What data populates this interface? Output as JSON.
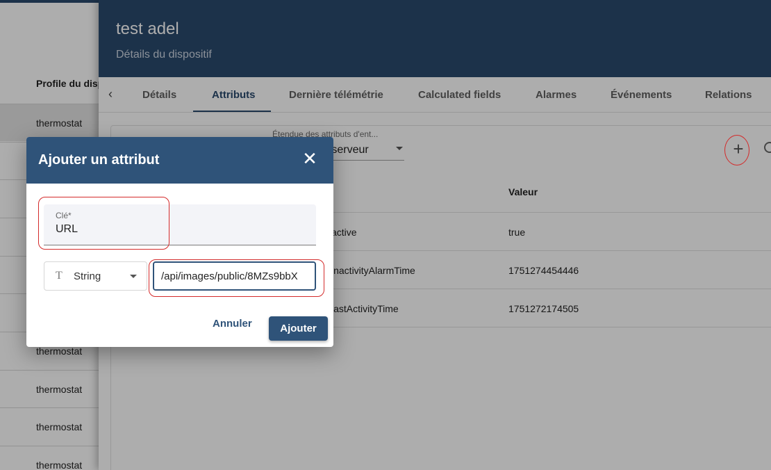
{
  "device_list": {
    "column_header": "Profile du dispositif",
    "rows": [
      "thermostat",
      "",
      "",
      "",
      "",
      "",
      "thermostat",
      "thermostat",
      "thermostat",
      "thermostat"
    ]
  },
  "details": {
    "title": "test adel",
    "subtitle": "Détails du dispositif",
    "tabs": [
      "Détails",
      "Attributs",
      "Dernière télémétrie",
      "Calculated fields",
      "Alarmes",
      "Événements",
      "Relations"
    ],
    "active_tab": "Attributs",
    "scope": {
      "label": "Étendue des attributs d'ent...",
      "value": "Attributs du serveur"
    },
    "table": {
      "column_value": "Valeur",
      "rows": [
        {
          "key": "active",
          "value": "true"
        },
        {
          "key": "inactivityAlarmTime",
          "value": "1751274454446"
        },
        {
          "key": "lastActivityTime",
          "value": "1751272174505"
        }
      ]
    }
  },
  "dialog": {
    "title": "Ajouter un attribut",
    "key_label": "Clé*",
    "key_value": "URL",
    "type_value": "String",
    "value_text": "/api/images/public/8MZs9bbX",
    "cancel_label": "Annuler",
    "add_label": "Ajouter"
  },
  "colors": {
    "primary": "#2f5379",
    "header": "#2a4a6e",
    "annotation": "#d42a2a"
  }
}
